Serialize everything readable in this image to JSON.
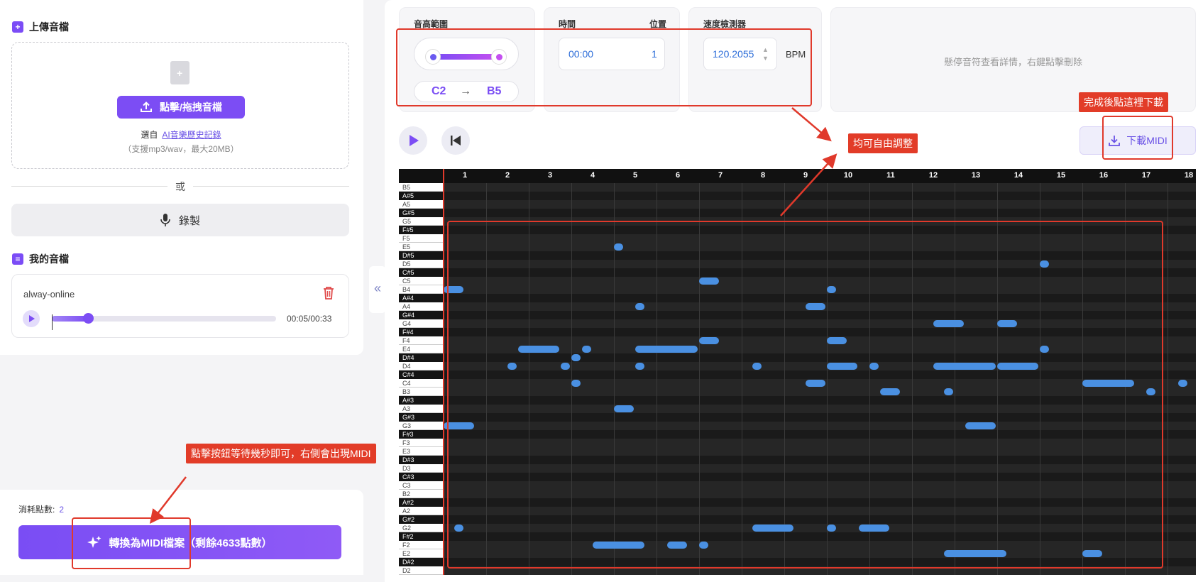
{
  "upload": {
    "section_title": "上傳音檔",
    "button_label": "點擊/拖拽音檔",
    "choose_prefix": "選自",
    "history_link": "AI音樂歷史記錄",
    "format_hint": "（支援mp3/wav，最大20MB）"
  },
  "divider_text": "或",
  "record_label": "錄製",
  "my_files": {
    "section_title": "我的音檔",
    "file_name": "alway-online",
    "time": "00:05/00:33",
    "progress": 0.16
  },
  "cost": {
    "label": "消耗點數:",
    "value": "2"
  },
  "convert_button": "轉換為MIDI檔案（剩餘4633點數）",
  "controls": {
    "pitch_range": {
      "label": "音高範圍",
      "low": "C2",
      "arrow": "→",
      "high": "B5"
    },
    "time": {
      "label": "時間",
      "position_label": "位置",
      "time_value": "00:00",
      "position_value": "1"
    },
    "tempo": {
      "label": "速度檢測器",
      "value": "120.2055",
      "unit": "BPM"
    },
    "info_hint": "懸停音符查看詳情，右鍵點擊刪除",
    "download_label": "下載MIDI"
  },
  "piano_roll": {
    "beats": [
      "1",
      "2",
      "3",
      "4",
      "5",
      "6",
      "7",
      "8",
      "9",
      "10",
      "11",
      "12",
      "13",
      "14",
      "15",
      "16",
      "17",
      "18"
    ],
    "keys": [
      "B5",
      "A#5",
      "A5",
      "G#5",
      "G5",
      "F#5",
      "F5",
      "E5",
      "D#5",
      "D5",
      "C#5",
      "C5",
      "B4",
      "A#4",
      "A4",
      "G#4",
      "G4",
      "F#4",
      "F4",
      "E4",
      "D#4",
      "D4",
      "C#4",
      "C4",
      "B3",
      "A#3",
      "A3",
      "G#3",
      "G3",
      "F#3",
      "F3",
      "E3",
      "D#3",
      "D3",
      "C#3",
      "C3",
      "B2",
      "A#2",
      "A2",
      "G#2",
      "G2",
      "F#2",
      "F2",
      "E2",
      "D#2",
      "D2"
    ],
    "notes": [
      {
        "pitch": "E5",
        "start": 5.0,
        "len": 0.25
      },
      {
        "pitch": "D5",
        "start": 15.0,
        "len": 0.25
      },
      {
        "pitch": "C5",
        "start": 7.0,
        "len": 0.5
      },
      {
        "pitch": "B4",
        "start": 1.0,
        "len": 0.5
      },
      {
        "pitch": "B4",
        "start": 10.0,
        "len": 0.25
      },
      {
        "pitch": "A4",
        "start": 5.5,
        "len": 0.25
      },
      {
        "pitch": "A4",
        "start": 9.5,
        "len": 0.5
      },
      {
        "pitch": "G4",
        "start": 12.5,
        "len": 0.75
      },
      {
        "pitch": "G4",
        "start": 14.0,
        "len": 0.5
      },
      {
        "pitch": "F4",
        "start": 7.0,
        "len": 0.5
      },
      {
        "pitch": "F4",
        "start": 10.0,
        "len": 0.5
      },
      {
        "pitch": "E4",
        "start": 2.75,
        "len": 1.0
      },
      {
        "pitch": "E4",
        "start": 4.25,
        "len": 0.25
      },
      {
        "pitch": "E4",
        "start": 5.5,
        "len": 1.5
      },
      {
        "pitch": "E4",
        "start": 15.0,
        "len": 0.25
      },
      {
        "pitch": "D#4",
        "start": 4.0,
        "len": 0.25
      },
      {
        "pitch": "D4",
        "start": 2.5,
        "len": 0.25
      },
      {
        "pitch": "D4",
        "start": 3.75,
        "len": 0.25
      },
      {
        "pitch": "D4",
        "start": 5.5,
        "len": 0.25
      },
      {
        "pitch": "D4",
        "start": 8.25,
        "len": 0.25
      },
      {
        "pitch": "D4",
        "start": 10.0,
        "len": 0.75
      },
      {
        "pitch": "D4",
        "start": 11.0,
        "len": 0.25
      },
      {
        "pitch": "D4",
        "start": 12.5,
        "len": 1.5
      },
      {
        "pitch": "D4",
        "start": 14.0,
        "len": 1.0
      },
      {
        "pitch": "C4",
        "start": 4.0,
        "len": 0.25
      },
      {
        "pitch": "C4",
        "start": 9.5,
        "len": 0.5
      },
      {
        "pitch": "C4",
        "start": 16.0,
        "len": 1.25
      },
      {
        "pitch": "C4",
        "start": 18.25,
        "len": 0.25
      },
      {
        "pitch": "B3",
        "start": 11.25,
        "len": 0.5
      },
      {
        "pitch": "B3",
        "start": 12.75,
        "len": 0.25
      },
      {
        "pitch": "B3",
        "start": 17.5,
        "len": 0.25
      },
      {
        "pitch": "A3",
        "start": 5.0,
        "len": 0.5
      },
      {
        "pitch": "G3",
        "start": 1.0,
        "len": 0.75
      },
      {
        "pitch": "G3",
        "start": 13.25,
        "len": 0.75
      },
      {
        "pitch": "G2",
        "start": 1.25,
        "len": 0.25
      },
      {
        "pitch": "G2",
        "start": 8.25,
        "len": 1.0
      },
      {
        "pitch": "G2",
        "start": 10.0,
        "len": 0.25
      },
      {
        "pitch": "G2",
        "start": 10.75,
        "len": 0.75
      },
      {
        "pitch": "F2",
        "start": 4.5,
        "len": 1.25
      },
      {
        "pitch": "F2",
        "start": 6.25,
        "len": 0.5
      },
      {
        "pitch": "F2",
        "start": 7.0,
        "len": 0.25
      },
      {
        "pitch": "E2",
        "start": 12.75,
        "len": 1.5
      },
      {
        "pitch": "E2",
        "start": 16.0,
        "len": 0.5
      }
    ]
  },
  "annotations": {
    "adjust": "均可自由調整",
    "download_hint": "完成後點這裡下載",
    "convert_hint": "點擊按鈕等待幾秒即可，右側會出現MIDI"
  },
  "colors": {
    "accent": "#7c4df4",
    "note": "#4a90e2",
    "annotation": "#e23c28"
  }
}
